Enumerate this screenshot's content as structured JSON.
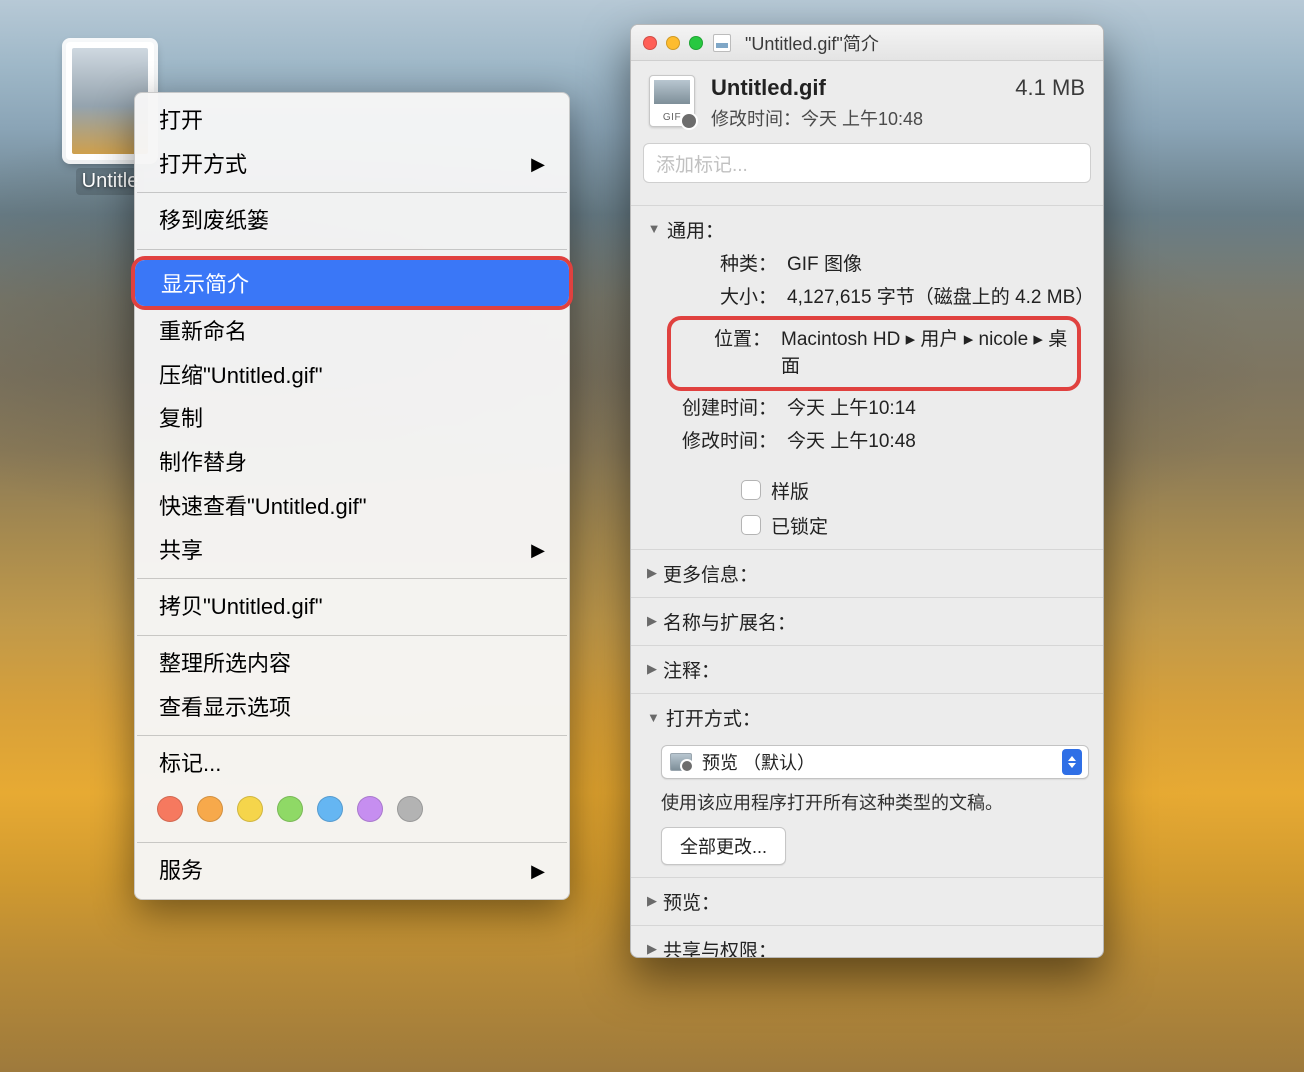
{
  "desktop_icon": {
    "label": "Untitle"
  },
  "context_menu": {
    "open": "打开",
    "open_with": "打开方式",
    "move_to_trash": "移到废纸篓",
    "get_info": "显示简介",
    "rename": "重新命名",
    "compress": "压缩\"Untitled.gif\"",
    "duplicate": "复制",
    "make_alias": "制作替身",
    "quick_look": "快速查看\"Untitled.gif\"",
    "share": "共享",
    "copy": "拷贝\"Untitled.gif\"",
    "clean_up": "整理所选内容",
    "view_options": "查看显示选项",
    "tags": "标记...",
    "services": "服务"
  },
  "info": {
    "window_title": "\"Untitled.gif\"简介",
    "file_name": "Untitled.gif",
    "file_size": "4.1 MB",
    "modified_line": "修改时间：今天 上午10:48",
    "tags_placeholder": "添加标记...",
    "sections": {
      "general": "通用：",
      "more_info": "更多信息：",
      "name_ext": "名称与扩展名：",
      "comments": "注释：",
      "open_with": "打开方式：",
      "preview": "预览：",
      "sharing": "共享与权限："
    },
    "kv": {
      "kind_label": "种类：",
      "kind_value": "GIF 图像",
      "size_label": "大小：",
      "size_value": "4,127,615 字节（磁盘上的 4.2 MB）",
      "where_label": "位置：",
      "where_value": "Macintosh HD ▸ 用户 ▸ nicole ▸ 桌面",
      "created_label": "创建时间：",
      "created_value": "今天 上午10:14",
      "modified_label": "修改时间：",
      "modified_value": "今天 上午10:48",
      "stationery": "样版",
      "locked": "已锁定"
    },
    "open_with": {
      "app": "预览 （默认）",
      "hint": "使用该应用程序打开所有这种类型的文稿。",
      "change_all": "全部更改..."
    }
  }
}
